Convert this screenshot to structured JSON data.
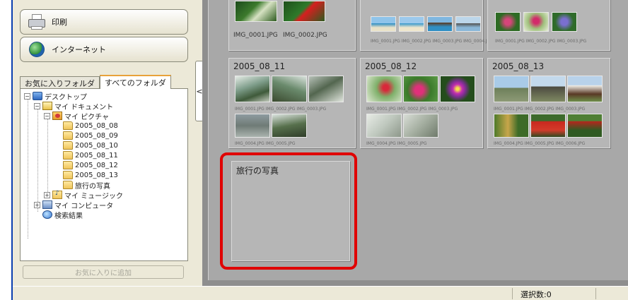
{
  "sidebar": {
    "print_label": "印刷",
    "internet_label": "インターネット",
    "tabs": [
      {
        "label": "お気に入りフォルダ"
      },
      {
        "label": "すべてのフォルダ"
      }
    ],
    "tree": [
      {
        "label": "デスクトップ",
        "toggle": "−",
        "icon": "desktop-icon"
      },
      {
        "label": "マイ ドキュメント",
        "toggle": "−",
        "icon": "documents-folder-icon"
      },
      {
        "label": "マイ ピクチャ",
        "toggle": "−",
        "icon": "pictures-folder-icon"
      },
      {
        "label": "2005_08_08",
        "icon": "folder-icon"
      },
      {
        "label": "2005_08_09",
        "icon": "folder-icon"
      },
      {
        "label": "2005_08_10",
        "icon": "folder-icon"
      },
      {
        "label": "2005_08_11",
        "icon": "folder-icon"
      },
      {
        "label": "2005_08_12",
        "icon": "folder-icon"
      },
      {
        "label": "2005_08_13",
        "icon": "folder-icon"
      },
      {
        "label": "旅行の写真",
        "icon": "folder-icon"
      },
      {
        "label": "マイ ミュージック",
        "toggle": "+",
        "icon": "music-folder-icon"
      },
      {
        "label": "マイ コンピュータ",
        "toggle": "+",
        "icon": "computer-icon"
      },
      {
        "label": "検索結果",
        "icon": "search-results-icon"
      }
    ],
    "add_favorite_label": "お気に入りに追加"
  },
  "splitter": {
    "collapse_glyph": "<"
  },
  "main": {
    "top_labels": [
      "IMG_0001.JPG",
      "IMG_0002.JPG"
    ],
    "groups": [
      {
        "title": "2005_08_11",
        "labels_row1": "IMG_0001.JPG  IMG_0002.JPG  IMG_0003.JPG",
        "labels_row2": "IMG_0004.JPG  IMG_0005.JPG"
      },
      {
        "title": "2005_08_12",
        "labels_row1": "IMG_0001.JPG  IMG_0002.JPG  IMG_0003.JPG",
        "labels_row2": "IMG_0004.JPG  IMG_0005.JPG"
      },
      {
        "title": "2005_08_13",
        "labels_row1": "IMG_0001.JPG  IMG_0002.JPG  IMG_0003.JPG",
        "labels_row2": "IMG_0004.JPG  IMG_0005.JPG  IMG_0006.JPG"
      },
      {
        "title": "旅行の写真"
      }
    ],
    "top_row_labels_mid": "IMG_0001.JPG  IMG_0002.JPG  IMG_0003.JPG  IMG_0004.JPG",
    "top_row_labels_right": "IMG_0001.JPG  IMG_0002.JPG  IMG_0003.JPG"
  },
  "status": {
    "selection_count": "選択数:0"
  },
  "colors": {
    "highlight": "#e00000",
    "accent_tab": "#e8a23a"
  }
}
